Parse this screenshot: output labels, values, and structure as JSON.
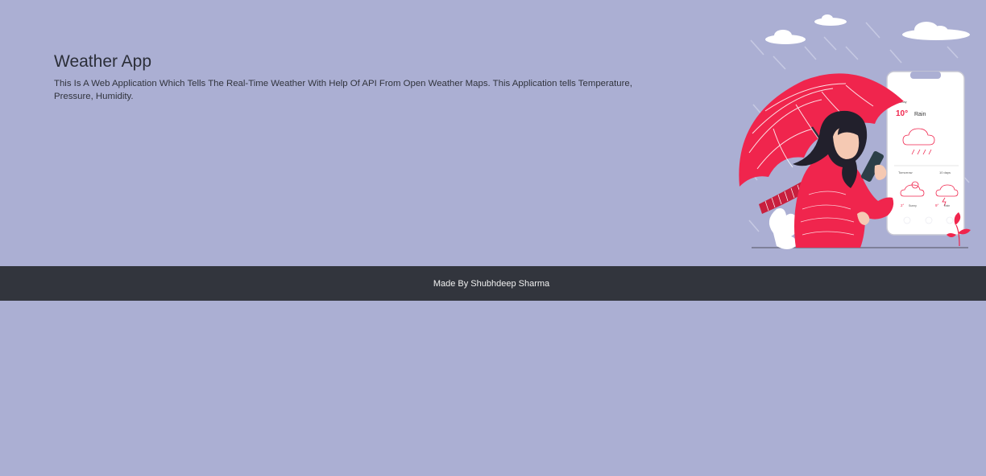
{
  "hero": {
    "title": "Weather App",
    "description": "This Is A Web Application Which Tells The Real-Time Weather With Help Of API From Open Weather Maps. This Application tells Temperature, Pressure, Humidity."
  },
  "illustration": {
    "icon": "woman-with-umbrella-and-phone-illustration",
    "phone": {
      "today_label": "Today",
      "today_temp": "10°",
      "today_condition": "Rain",
      "tomorrow_label": "Tomorrow",
      "days_label": "10 days",
      "tomorrow_temp": "2°",
      "tomorrow_condition": "Sunny",
      "days_temp": "9°",
      "days_condition": "Rain"
    }
  },
  "footer": {
    "text": "Made By Shubhdeep Sharma"
  },
  "colors": {
    "background": "#abafd3",
    "footer": "#32353d",
    "accent": "#f0254d"
  }
}
